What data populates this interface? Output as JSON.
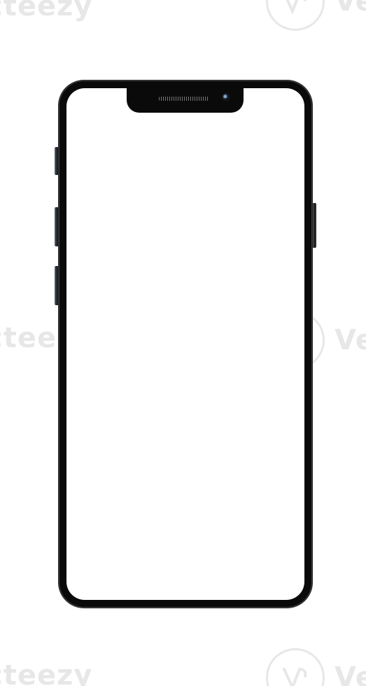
{
  "watermark": {
    "brand": "Vecteezy",
    "fragment_left": "cteezy"
  },
  "device": {
    "name": "smartphone-mockup",
    "screen_color": "#ffffff",
    "frame_color": "#0a0a0a"
  }
}
